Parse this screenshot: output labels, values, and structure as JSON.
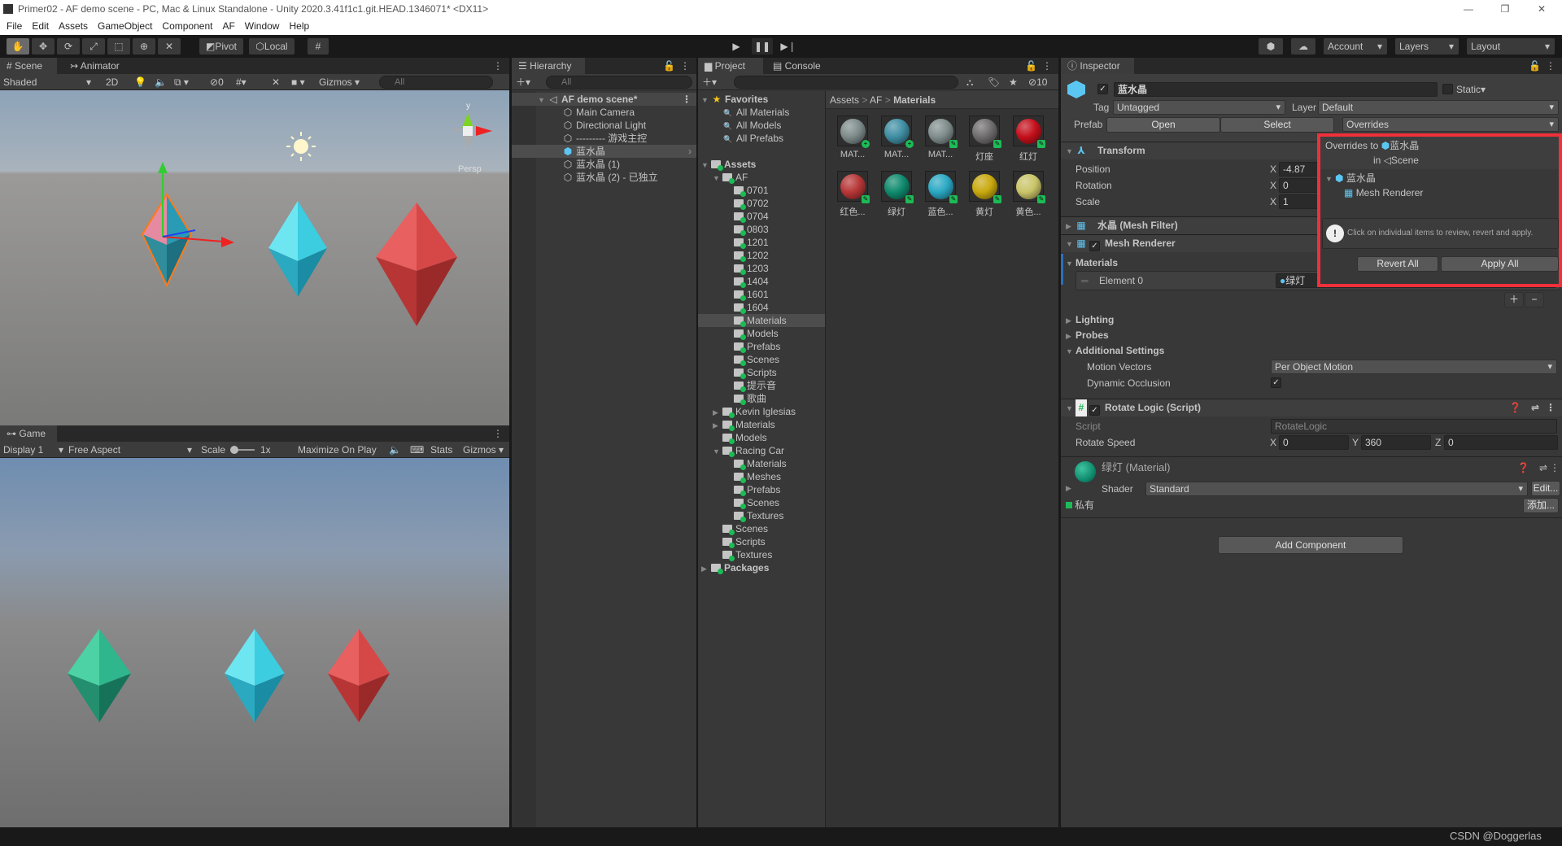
{
  "window": {
    "title": "Primer02 - AF demo scene - PC, Mac & Linux Standalone - Unity 2020.3.41f1c1.git.HEAD.1346071* <DX11>"
  },
  "menu": [
    "File",
    "Edit",
    "Assets",
    "GameObject",
    "Component",
    "AF",
    "Window",
    "Help"
  ],
  "toolbar": {
    "pivot": "Pivot",
    "local": "Local",
    "account": "Account",
    "layers": "Layers",
    "layout": "Layout"
  },
  "scene": {
    "tabs": [
      "Scene",
      "Animator"
    ],
    "shading": "Shaded",
    "mode_2d": "2D",
    "hidden_count": "0",
    "gizmos": "Gizmos",
    "search_placeholder": "All",
    "gizmo_label": "Persp",
    "gizmo_axis_y": "y"
  },
  "game": {
    "tab": "Game",
    "display": "Display 1",
    "aspect": "Free Aspect",
    "scale_label": "Scale",
    "scale_value": "1x",
    "maximize": "Maximize On Play",
    "stats": "Stats",
    "gizmos": "Gizmos"
  },
  "hierarchy": {
    "tab": "Hierarchy",
    "search_placeholder": "All",
    "scene": "AF demo scene*",
    "items": [
      {
        "label": "Main Camera"
      },
      {
        "label": "Directional Light"
      },
      {
        "label": "--------- 游戏主控"
      },
      {
        "label": "蓝水晶",
        "selected": true
      },
      {
        "label": "蓝水晶 (1)"
      },
      {
        "label": "蓝水晶 (2) - 已独立"
      }
    ]
  },
  "project": {
    "tabs": [
      "Project",
      "Console"
    ],
    "hidden_count": "10",
    "breadcrumb": [
      "Assets",
      "AF",
      "Materials"
    ],
    "tree": [
      {
        "label": "Favorites",
        "level": 0,
        "kind": "fav",
        "open": true
      },
      {
        "label": "All Materials",
        "level": 1,
        "kind": "search"
      },
      {
        "label": "All Models",
        "level": 1,
        "kind": "search"
      },
      {
        "label": "All Prefabs",
        "level": 1,
        "kind": "search"
      },
      {
        "label": "",
        "level": 0,
        "kind": "gap"
      },
      {
        "label": "Assets",
        "level": 0,
        "kind": "folder",
        "open": true
      },
      {
        "label": "AF",
        "level": 1,
        "kind": "folder",
        "open": true
      },
      {
        "label": "0701",
        "level": 2,
        "kind": "folder"
      },
      {
        "label": "0702",
        "level": 2,
        "kind": "folder"
      },
      {
        "label": "0704",
        "level": 2,
        "kind": "folder"
      },
      {
        "label": "0803",
        "level": 2,
        "kind": "folder"
      },
      {
        "label": "1201",
        "level": 2,
        "kind": "folder"
      },
      {
        "label": "1202",
        "level": 2,
        "kind": "folder"
      },
      {
        "label": "1203",
        "level": 2,
        "kind": "folder"
      },
      {
        "label": "1404",
        "level": 2,
        "kind": "folder"
      },
      {
        "label": "1601",
        "level": 2,
        "kind": "folder"
      },
      {
        "label": "1604",
        "level": 2,
        "kind": "folder"
      },
      {
        "label": "Materials",
        "level": 2,
        "kind": "folder",
        "selected": true
      },
      {
        "label": "Models",
        "level": 2,
        "kind": "folder"
      },
      {
        "label": "Prefabs",
        "level": 2,
        "kind": "folder"
      },
      {
        "label": "Scenes",
        "level": 2,
        "kind": "folder"
      },
      {
        "label": "Scripts",
        "level": 2,
        "kind": "folder"
      },
      {
        "label": "提示音",
        "level": 2,
        "kind": "folder"
      },
      {
        "label": "歌曲",
        "level": 2,
        "kind": "folder"
      },
      {
        "label": "Kevin Iglesias",
        "level": 1,
        "kind": "folder",
        "open": false
      },
      {
        "label": "Materials",
        "level": 1,
        "kind": "folder",
        "open": false
      },
      {
        "label": "Models",
        "level": 1,
        "kind": "folder"
      },
      {
        "label": "Racing Car",
        "level": 1,
        "kind": "folder",
        "open": true
      },
      {
        "label": "Materials",
        "level": 2,
        "kind": "folder"
      },
      {
        "label": "Meshes",
        "level": 2,
        "kind": "folder"
      },
      {
        "label": "Prefabs",
        "level": 2,
        "kind": "folder"
      },
      {
        "label": "Scenes",
        "level": 2,
        "kind": "folder"
      },
      {
        "label": "Textures",
        "level": 2,
        "kind": "folder"
      },
      {
        "label": "Scenes",
        "level": 1,
        "kind": "folder"
      },
      {
        "label": "Scripts",
        "level": 1,
        "kind": "folder"
      },
      {
        "label": "Textures",
        "level": 1,
        "kind": "folder"
      },
      {
        "label": "Packages",
        "level": 0,
        "kind": "pkg",
        "open": false
      }
    ],
    "materials": [
      {
        "label": "MAT...",
        "color": "#7e8b8b",
        "badge": "added"
      },
      {
        "label": "MAT...",
        "color": "#3f8ea3",
        "badge": "added"
      },
      {
        "label": "MAT...",
        "color": "#808d8d",
        "badge": "edit"
      },
      {
        "label": "灯座",
        "color": "#6f6d6d",
        "badge": "edit"
      },
      {
        "label": "红灯",
        "color": "#c4101b",
        "badge": "edit"
      },
      {
        "label": "红色...",
        "color": "#b63636",
        "badge": "edit"
      },
      {
        "label": "绿灯",
        "color": "#0f8a6d",
        "badge": "edit"
      },
      {
        "label": "蓝色...",
        "color": "#2aa8c3",
        "badge": "edit"
      },
      {
        "label": "黄灯",
        "color": "#c8a80e",
        "badge": "edit"
      },
      {
        "label": "黄色...",
        "color": "#c9c468",
        "badge": "edit"
      }
    ]
  },
  "inspector": {
    "tab": "Inspector",
    "name": "蓝水晶",
    "static": "Static",
    "tag_label": "Tag",
    "tag": "Untagged",
    "layer_label": "Layer",
    "layer": "Default",
    "prefab_label": "Prefab",
    "open": "Open",
    "select": "Select",
    "overrides": "Overrides",
    "transform": {
      "title": "Transform",
      "position": "Position",
      "rotation": "Rotation",
      "scale": "Scale",
      "px": "-4.87",
      "rx": "0",
      "sx": "1"
    },
    "mesh_filter": "水晶 (Mesh Filter)",
    "mesh_renderer": "Mesh Renderer",
    "materials": "Materials",
    "element0": "Element 0",
    "element0_value": "绿灯",
    "lighting": "Lighting",
    "probes": "Probes",
    "additional": "Additional Settings",
    "motion_vectors": "Motion Vectors",
    "motion_value": "Per Object Motion",
    "dynamic_occlusion": "Dynamic Occlusion",
    "rotate": {
      "title": "Rotate Logic (Script)",
      "script_label": "Script",
      "script": "RotateLogic",
      "speed_label": "Rotate Speed",
      "x": "0",
      "y": "360",
      "z": "0"
    },
    "material": {
      "title": "绿灯 (Material)",
      "shader_label": "Shader",
      "shader": "Standard",
      "edit": "Edit...",
      "private": "私有",
      "add": "添加...",
      "color": "#0f8a6d"
    },
    "add_component": "Add Component",
    "popup": {
      "title": "Overrides to",
      "target": "蓝水晶",
      "in": "in",
      "scene": "Scene",
      "root": "蓝水晶",
      "child": "Mesh Renderer",
      "info": "Click on individual items to review, revert and apply.",
      "revert": "Revert All",
      "apply": "Apply All",
      "highlight": "#f0303a"
    }
  },
  "watermark": "CSDN @Doggerlas",
  "colors": {
    "crystal_cyan": "#3ccde0",
    "crystal_red": "#e04b4b",
    "crystal_green": "#2fb68c",
    "selection_outline": "#ff7a1a"
  }
}
